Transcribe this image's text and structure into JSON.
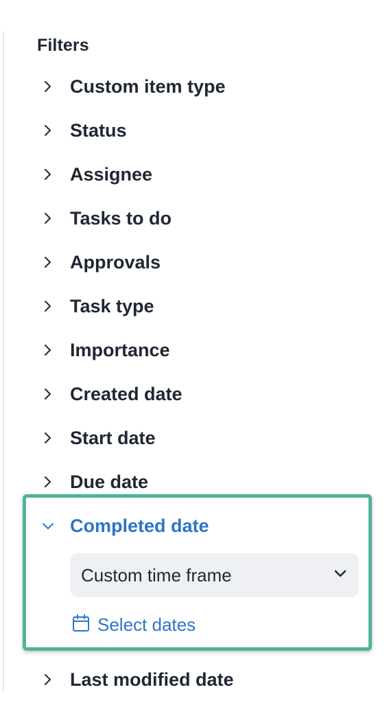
{
  "filters": {
    "title": "Filters",
    "items": [
      {
        "label": "Custom item type"
      },
      {
        "label": "Status"
      },
      {
        "label": "Assignee"
      },
      {
        "label": "Tasks to do"
      },
      {
        "label": "Approvals"
      },
      {
        "label": "Task type"
      },
      {
        "label": "Importance"
      },
      {
        "label": "Created date"
      },
      {
        "label": "Start date"
      },
      {
        "label": "Due date"
      },
      {
        "label": "Completed date"
      },
      {
        "label": "Last modified date"
      }
    ],
    "expanded": {
      "label": "Completed date",
      "time_frame_value": "Custom time frame",
      "select_dates_label": "Select dates"
    }
  },
  "colors": {
    "text": "#1f2733",
    "accent_blue": "#2e74c9",
    "highlight_border": "#4fb49b",
    "select_bg": "#eef0f4"
  },
  "icons": {
    "collapsed": "chevron-right-icon",
    "expanded": "chevron-down-icon",
    "dropdown": "chevron-down-icon",
    "calendar": "calendar-icon"
  }
}
